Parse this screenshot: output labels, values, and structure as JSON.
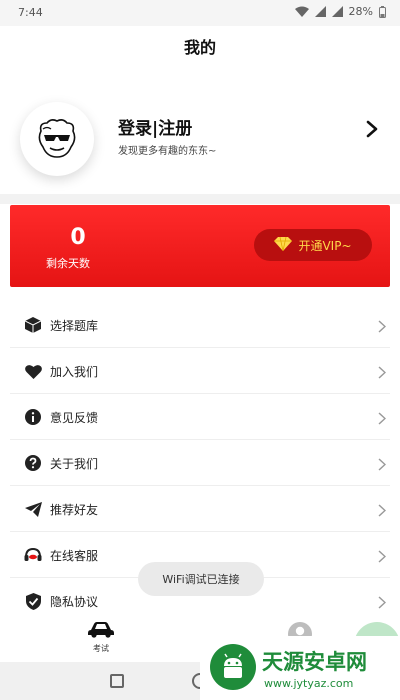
{
  "status_bar": {
    "time": "7:44",
    "battery": "28%"
  },
  "header": {
    "title": "我的"
  },
  "profile": {
    "login_label": "登录|注册",
    "subtitle": "发现更多有趣的东东~"
  },
  "vip": {
    "days_value": "0",
    "days_label": "剩余天数",
    "button_label": "开通VIP~"
  },
  "menu": {
    "items": [
      {
        "label": "选择题库",
        "icon": "cube-icon"
      },
      {
        "label": "加入我们",
        "icon": "heart-icon"
      },
      {
        "label": "意见反馈",
        "icon": "info-icon"
      },
      {
        "label": "关于我们",
        "icon": "help-icon"
      },
      {
        "label": "推荐好友",
        "icon": "send-icon"
      },
      {
        "label": "在线客服",
        "icon": "headset-icon"
      },
      {
        "label": "隐私协议",
        "icon": "shield-check-icon"
      }
    ]
  },
  "toast": {
    "text": "WiFi调试已连接"
  },
  "tabbar": {
    "exam_label": "考试"
  },
  "watermark": {
    "title": "天源安卓网",
    "url": "www.jytyaz.com"
  },
  "colors": {
    "accent_red": "#e51414",
    "vip_gold": "#ffd84a",
    "brand_green": "#1f8c3a"
  }
}
